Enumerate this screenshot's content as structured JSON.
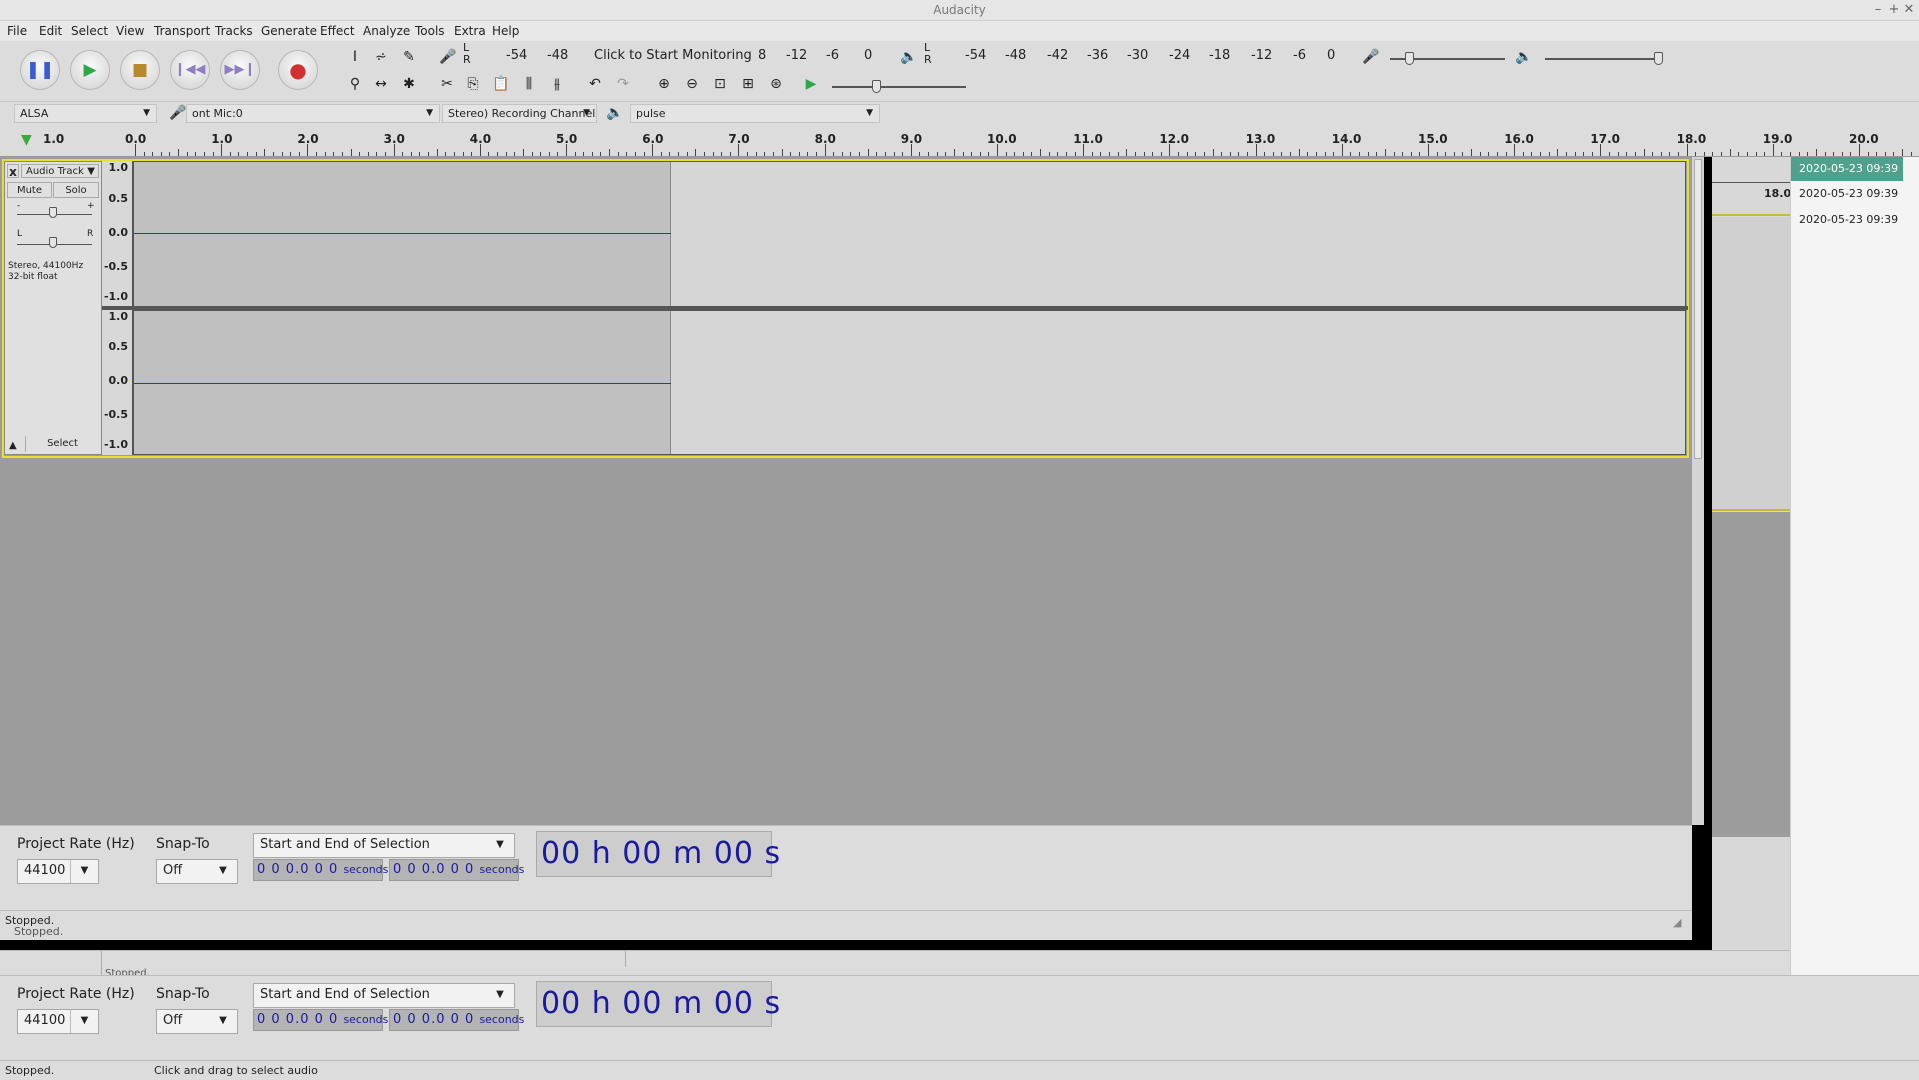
{
  "window": {
    "title": "Audacity",
    "minimize": "–",
    "maximize": "+",
    "close": "✕"
  },
  "menu": [
    "File",
    "Edit",
    "Select",
    "View",
    "Transport",
    "Tracks",
    "Generate",
    "Effect",
    "Analyze",
    "Tools",
    "Extra",
    "Help"
  ],
  "meters": {
    "recording_scale": [
      "-54",
      "-48",
      "Click to Start Monitoring",
      "8",
      "-12",
      "-6",
      "0"
    ],
    "playback_scale": [
      "-54",
      "-48",
      "-42",
      "-36",
      "-30",
      "-24",
      "-18",
      "-12",
      "-6",
      "0"
    ],
    "lr": [
      "L",
      "R"
    ]
  },
  "device_toolbar": {
    "host": "ALSA",
    "recording_device": "ont Mic:0",
    "channels": "Stereo) Recording Channels",
    "playback_device": "pulse"
  },
  "ruler": {
    "start_label": "1.0",
    "labels": [
      "0.0",
      "1.0",
      "2.0",
      "3.0",
      "4.0",
      "5.0",
      "6.0",
      "7.0",
      "8.0",
      "9.0",
      "10.0",
      "11.0",
      "12.0",
      "13.0",
      "14.0",
      "15.0",
      "16.0",
      "17.0",
      "18.0",
      "19.0",
      "20.0"
    ]
  },
  "track": {
    "close": "x",
    "name": "Audio Track",
    "mute": "Mute",
    "solo": "Solo",
    "gain_minus": "-",
    "gain_plus": "+",
    "pan_left": "L",
    "pan_right": "R",
    "info_line1": "Stereo, 44100Hz",
    "info_line2": "32-bit float",
    "select": "Select",
    "amplitude_labels": [
      "1.0",
      "0.5",
      "0.0",
      "-0.5",
      "-1.0"
    ]
  },
  "background_window": {
    "list": [
      "2020-05-23 09:39",
      "2020-05-23 09:39",
      "2020-05-23 09:39"
    ],
    "ruler_label": "18.0",
    "status": "Stopped."
  },
  "selection_toolbar": {
    "project_rate_label": "Project Rate (Hz)",
    "project_rate": "44100",
    "snap_to_label": "Snap-To",
    "snap_to": "Off",
    "selection_mode": "Start and End of Selection",
    "start_time": "0 0 0.0 0 0",
    "end_time": "0 0 0.0 0 0",
    "time_unit": "seconds",
    "audio_position": "00 h 00 m 00 s"
  },
  "status": {
    "state": "Stopped.",
    "state_behind": "Stopped.",
    "hint": "Click and drag to select audio"
  }
}
